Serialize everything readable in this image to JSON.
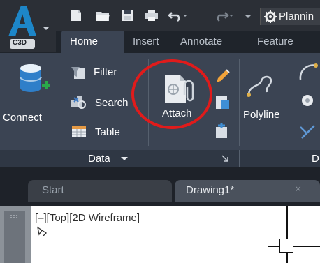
{
  "app": {
    "logo_letter": "A",
    "logo_badge": "C3D"
  },
  "workspace": {
    "label": "Plannin"
  },
  "tabs": [
    "Home",
    "Insert",
    "Annotate",
    "Feature"
  ],
  "ribbon": {
    "connect_label": "Connect",
    "filter_label": "Filter",
    "search_label": "Search",
    "table_label": "Table",
    "attach_label": "Attach",
    "polyline_label": "Polyline",
    "data_panel_label": "Data",
    "next_panel_initial": "D"
  },
  "doc_tabs": {
    "start": "Start",
    "drawing": "Drawing1*",
    "close_glyph": "×"
  },
  "viewport": {
    "label": "[–][Top][2D Wireframe]"
  },
  "colors": {
    "accent": "#1d86c8",
    "highlight_circle": "#e01b1b"
  }
}
